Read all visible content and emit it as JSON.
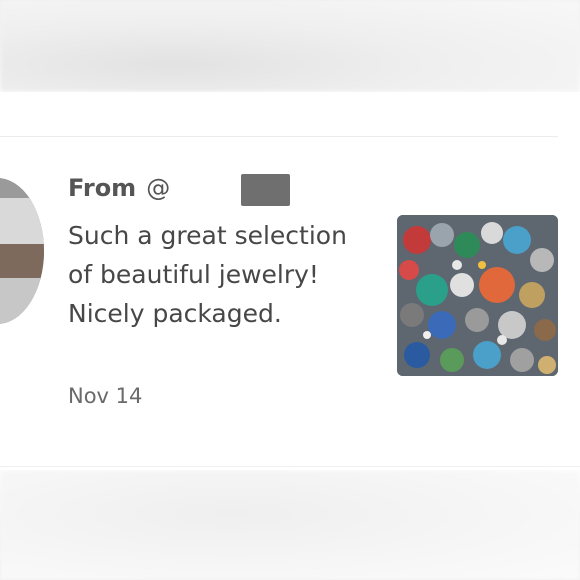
{
  "review": {
    "from_label": "From",
    "at_symbol": "@",
    "message": "Such a great selection of beautiful jewelry! Nicely packaged.",
    "date": "Nov 14"
  },
  "thumbnail": {
    "subject": "jewelry-lot-photo"
  },
  "colors": {
    "text_primary": "#474747",
    "text_secondary": "#6a6a6a",
    "redaction": "#6f6f6f"
  }
}
